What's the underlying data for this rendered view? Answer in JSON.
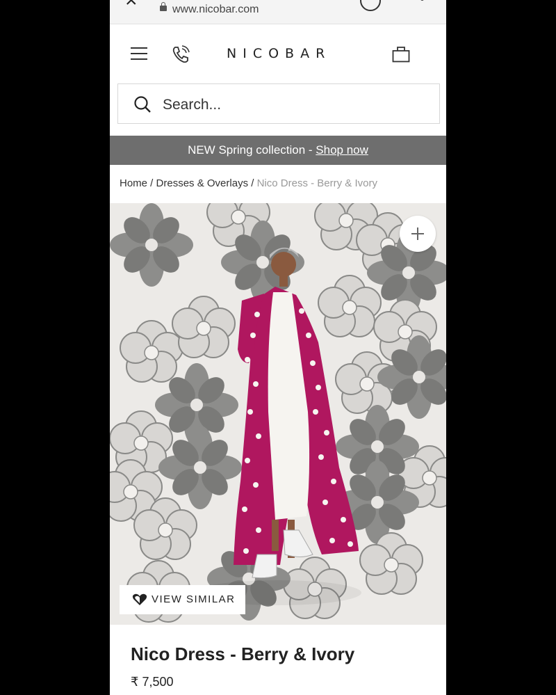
{
  "browser": {
    "url": "www.nicobar.com"
  },
  "header": {
    "logo": "NICOBAR"
  },
  "search": {
    "placeholder": "Search..."
  },
  "banner": {
    "text": "NEW Spring collection - ",
    "link": "Shop now"
  },
  "breadcrumb": {
    "home": "Home",
    "sep1": " / ",
    "category": "Dresses & Overlays",
    "sep2": " / ",
    "current": "Nico Dress - Berry & Ivory"
  },
  "product": {
    "view_similar": "VIEW SIMILAR",
    "title": "Nico Dress - Berry & Ivory",
    "price": "₹ 7,500"
  },
  "colors": {
    "banner": "#6e6e6e",
    "berry": "#b0175f",
    "ivory": "#f4f2ee"
  }
}
